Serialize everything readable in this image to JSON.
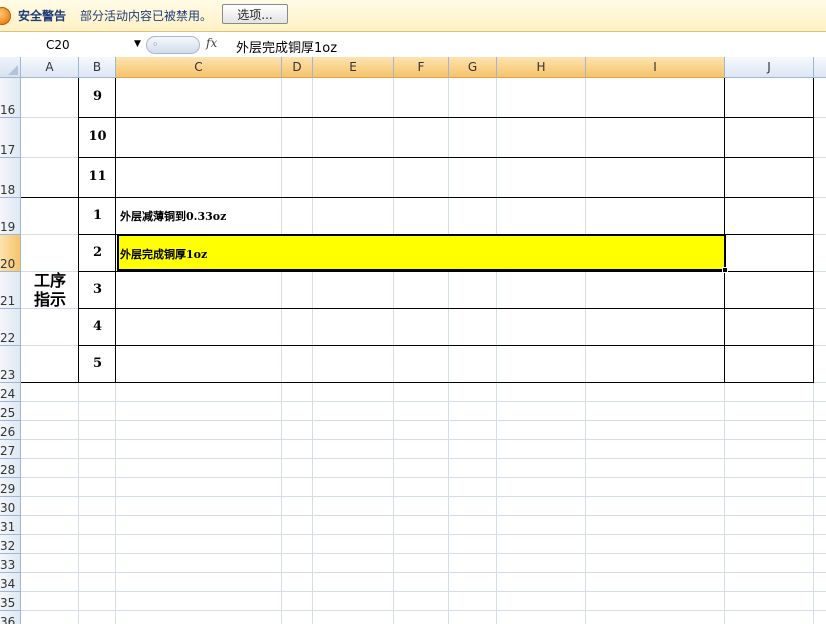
{
  "message_bar": {
    "title": "安全警告",
    "text": "部分活动内容已被禁用。",
    "options_label": "选项..."
  },
  "formula_bar": {
    "name_box": "C20",
    "fx": "fx",
    "formula": "外层完成铜厚1oz"
  },
  "colors": {
    "selected_fill": "#ffff00",
    "header_selected": "#f6c46a",
    "gridline": "#d4dde9"
  },
  "columns": [
    "A",
    "B",
    "C",
    "D",
    "E",
    "F",
    "G",
    "H",
    "I",
    "J"
  ],
  "rows": [
    "16",
    "17",
    "18",
    "19",
    "20",
    "21",
    "22",
    "23",
    "24",
    "25",
    "26",
    "27",
    "28",
    "29",
    "30",
    "31",
    "32",
    "33",
    "34",
    "35",
    "36"
  ],
  "sheet": {
    "block_a_label": "工序\n指示",
    "numbers_top": [
      "9",
      "10",
      "11"
    ],
    "numbers_bottom": [
      "1",
      "2",
      "3",
      "4",
      "5"
    ],
    "c19": "外层减薄铜到0.33oz",
    "c20": "外层完成铜厚1oz"
  }
}
